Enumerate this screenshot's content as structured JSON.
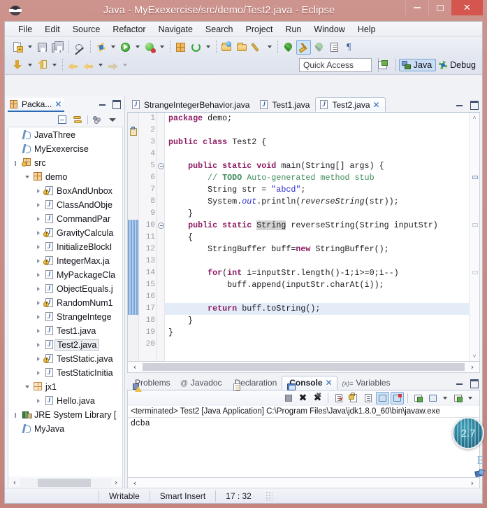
{
  "window": {
    "title": "Java - MyExexercise/src/demo/Test2.java - Eclipse",
    "app_icon": "eclipse-icon",
    "minimize": "minimize-icon",
    "maximize": "maximize-icon",
    "close": "✕"
  },
  "menubar": {
    "items": [
      "File",
      "Edit",
      "Source",
      "Refactor",
      "Navigate",
      "Search",
      "Project",
      "Run",
      "Window",
      "Help"
    ]
  },
  "toolbar": {
    "quick_access_placeholder": "Quick Access",
    "perspectives": [
      {
        "label": "Java",
        "icon": "java-perspective-icon",
        "selected": true
      },
      {
        "label": "Debug",
        "icon": "debug-perspective-icon",
        "selected": false
      }
    ],
    "open_perspective_icon": "open-perspective-icon",
    "row1_icons": [
      "new-wizard-icon",
      "save-icon",
      "save-all-icon",
      "skip-breakpoints-icon",
      "debug-icon",
      "run-icon",
      "run-coverage-icon",
      "new-java-package-icon",
      "external-tools-icon",
      "open-type-icon",
      "open-task-icon",
      "search-icon",
      "annotate-icon",
      "pin-icon",
      "toggle-mark-occurrences-icon",
      "next-annotation-icon",
      "show-whitespace-icon",
      "block-selection-icon"
    ],
    "row2_icons": [
      "previous-edit-icon",
      "next-edit-icon",
      "back-icon",
      "forward-history-icon",
      "forward-icon"
    ]
  },
  "explorer": {
    "view_title": "Packa...",
    "view_icon": "package-explorer-icon",
    "close_icon": "✕",
    "minimize_icon": "minimize-view-icon",
    "maximize_icon": "maximize-view-icon",
    "toolbar_icons": [
      "collapse-all-icon",
      "link-with-editor-icon",
      "focus-on-active-task-icon",
      "view-menu-icon"
    ],
    "tree": [
      {
        "label": "JavaThree",
        "indent": 0,
        "icon": "java-project-icon",
        "twist": "none",
        "selected": false
      },
      {
        "label": "MyExexercise",
        "indent": 0,
        "icon": "java-project-icon",
        "twist": "none",
        "selected": false
      },
      {
        "label": "src",
        "indent": 0,
        "icon": "source-folder-icon",
        "twist": "thin",
        "selected": false
      },
      {
        "label": "demo",
        "indent": 1,
        "icon": "package-icon",
        "twist": "open",
        "selected": false
      },
      {
        "label": "BoxAndUnbox",
        "indent": 2,
        "icon": "java-file-warn-icon",
        "twist": "closed",
        "selected": false
      },
      {
        "label": "ClassAndObje",
        "indent": 2,
        "icon": "java-file-icon",
        "twist": "closed",
        "selected": false
      },
      {
        "label": "CommandPar",
        "indent": 2,
        "icon": "java-file-icon",
        "twist": "closed",
        "selected": false
      },
      {
        "label": "GravityCalcula",
        "indent": 2,
        "icon": "java-file-warn-icon",
        "twist": "closed",
        "selected": false
      },
      {
        "label": "InitializeBlockI",
        "indent": 2,
        "icon": "java-file-icon",
        "twist": "closed",
        "selected": false
      },
      {
        "label": "IntegerMax.ja",
        "indent": 2,
        "icon": "java-file-warn-icon",
        "twist": "closed",
        "selected": false
      },
      {
        "label": "MyPackageCla",
        "indent": 2,
        "icon": "java-file-icon",
        "twist": "closed",
        "selected": false
      },
      {
        "label": "ObjectEquals.j",
        "indent": 2,
        "icon": "java-file-icon",
        "twist": "closed",
        "selected": false
      },
      {
        "label": "RandomNum1",
        "indent": 2,
        "icon": "java-file-warn-icon",
        "twist": "closed",
        "selected": false
      },
      {
        "label": "StrangeIntege",
        "indent": 2,
        "icon": "java-file-icon",
        "twist": "closed",
        "selected": false
      },
      {
        "label": "Test1.java",
        "indent": 2,
        "icon": "java-file-icon",
        "twist": "closed",
        "selected": false
      },
      {
        "label": "Test2.java",
        "indent": 2,
        "icon": "java-file-icon",
        "twist": "closed",
        "selected": true
      },
      {
        "label": "TestStatic.java",
        "indent": 2,
        "icon": "java-file-warn-icon",
        "twist": "closed",
        "selected": false
      },
      {
        "label": "TestStaticInitia",
        "indent": 2,
        "icon": "java-file-icon",
        "twist": "closed",
        "selected": false
      },
      {
        "label": "jx1",
        "indent": 1,
        "icon": "package-plain-icon",
        "twist": "open",
        "selected": false
      },
      {
        "label": "Hello.java",
        "indent": 2,
        "icon": "java-file-icon",
        "twist": "closed",
        "selected": false
      },
      {
        "label": "JRE System Library [",
        "indent": 0,
        "icon": "jre-library-icon",
        "twist": "thin",
        "selected": false
      },
      {
        "label": "MyJava",
        "indent": 0,
        "icon": "java-project-icon",
        "twist": "none",
        "selected": false
      }
    ],
    "hscroll": {
      "left_arrow": "‹",
      "right_arrow": "›"
    }
  },
  "editor": {
    "tabs": [
      {
        "label": "StrangeIntegerBehavior.java",
        "icon": "java-file-icon",
        "active": false,
        "closable": false
      },
      {
        "label": "Test1.java",
        "icon": "java-file-icon",
        "active": false,
        "closable": false
      },
      {
        "label": "Test2.java",
        "icon": "java-file-icon",
        "active": true,
        "closable": true,
        "close_icon": "✕"
      }
    ],
    "minimize_icon": "minimize-editor-icon",
    "maximize_icon": "maximize-editor-icon",
    "scroll_up_icon": "˄",
    "scroll_down_icon": "˅",
    "hscroll": {
      "left_arrow": "‹",
      "right_arrow": "›"
    },
    "lines": [
      {
        "n": 1,
        "fold": false,
        "changed": false,
        "hl": false,
        "tokens": [
          {
            "t": "package ",
            "c": "kw"
          },
          {
            "t": "demo;",
            "c": ""
          }
        ]
      },
      {
        "n": 2,
        "fold": false,
        "changed": false,
        "hl": false,
        "tokens": []
      },
      {
        "n": 3,
        "fold": false,
        "changed": false,
        "hl": false,
        "tokens": [
          {
            "t": "public class ",
            "c": "kw"
          },
          {
            "t": "Test2 {",
            "c": ""
          }
        ]
      },
      {
        "n": 4,
        "fold": false,
        "changed": false,
        "hl": false,
        "tokens": []
      },
      {
        "n": 5,
        "fold": true,
        "changed": false,
        "hl": false,
        "tokens": [
          {
            "t": "    ",
            "c": ""
          },
          {
            "t": "public static void ",
            "c": "kw"
          },
          {
            "t": "main(String[] args) {",
            "c": ""
          }
        ]
      },
      {
        "n": 6,
        "fold": false,
        "changed": false,
        "hl": false,
        "tokens": [
          {
            "t": "        ",
            "c": ""
          },
          {
            "t": "// ",
            "c": "cmt"
          },
          {
            "t": "TODO",
            "c": "todo"
          },
          {
            "t": " Auto-generated method stub",
            "c": "cmt"
          }
        ]
      },
      {
        "n": 7,
        "fold": false,
        "changed": false,
        "hl": false,
        "tokens": [
          {
            "t": "        String str = ",
            "c": ""
          },
          {
            "t": "\"abcd\"",
            "c": "str"
          },
          {
            "t": ";",
            "c": ""
          }
        ]
      },
      {
        "n": 8,
        "fold": false,
        "changed": false,
        "hl": false,
        "tokens": [
          {
            "t": "        System.",
            "c": ""
          },
          {
            "t": "out",
            "c": "fld"
          },
          {
            "t": ".println(",
            "c": ""
          },
          {
            "t": "reverseString",
            "c": "mth"
          },
          {
            "t": "(str));",
            "c": ""
          }
        ]
      },
      {
        "n": 9,
        "fold": false,
        "changed": false,
        "hl": false,
        "tokens": [
          {
            "t": "    }",
            "c": ""
          }
        ]
      },
      {
        "n": 10,
        "fold": true,
        "changed": true,
        "hl": false,
        "tokens": [
          {
            "t": "    ",
            "c": ""
          },
          {
            "t": "public static ",
            "c": "kw"
          },
          {
            "t": "String",
            "c": "hl-occ"
          },
          {
            "t": " reverseString(String inputStr)",
            "c": ""
          }
        ]
      },
      {
        "n": 11,
        "fold": false,
        "changed": true,
        "hl": false,
        "tokens": [
          {
            "t": "    {",
            "c": ""
          }
        ]
      },
      {
        "n": 12,
        "fold": false,
        "changed": true,
        "hl": false,
        "tokens": [
          {
            "t": "        StringBuffer buff=",
            "c": ""
          },
          {
            "t": "new ",
            "c": "kw"
          },
          {
            "t": "StringBuffer();",
            "c": ""
          }
        ]
      },
      {
        "n": 13,
        "fold": false,
        "changed": true,
        "hl": false,
        "tokens": []
      },
      {
        "n": 14,
        "fold": false,
        "changed": true,
        "hl": false,
        "tokens": [
          {
            "t": "        ",
            "c": ""
          },
          {
            "t": "for",
            "c": "kw"
          },
          {
            "t": "(",
            "c": ""
          },
          {
            "t": "int",
            "c": "kw"
          },
          {
            "t": " i=inputStr.length()-1;i>=0;i--)",
            "c": ""
          }
        ]
      },
      {
        "n": 15,
        "fold": false,
        "changed": true,
        "hl": false,
        "tokens": [
          {
            "t": "            buff.append(inputStr.charAt(i));",
            "c": ""
          }
        ]
      },
      {
        "n": 16,
        "fold": false,
        "changed": true,
        "hl": false,
        "tokens": []
      },
      {
        "n": 17,
        "fold": false,
        "changed": true,
        "hl": true,
        "tokens": [
          {
            "t": "        ",
            "c": ""
          },
          {
            "t": "return ",
            "c": "kw"
          },
          {
            "t": "buff.toString();",
            "c": ""
          }
        ]
      },
      {
        "n": 18,
        "fold": false,
        "changed": true,
        "hl": false,
        "tokens": [
          {
            "t": "    }",
            "c": ""
          }
        ]
      },
      {
        "n": 19,
        "fold": false,
        "changed": false,
        "hl": false,
        "tokens": [
          {
            "t": "}",
            "c": ""
          }
        ]
      },
      {
        "n": 20,
        "fold": false,
        "changed": false,
        "hl": false,
        "tokens": []
      }
    ],
    "todo_marker": "task-marker-icon"
  },
  "console": {
    "tabs": [
      {
        "label": "Problems",
        "icon": "problems-icon",
        "active": false,
        "closable": false
      },
      {
        "label": "Javadoc",
        "icon": "javadoc-icon",
        "active": false,
        "closable": false
      },
      {
        "label": "Declaration",
        "icon": "declaration-icon",
        "active": false,
        "closable": false
      },
      {
        "label": "Console",
        "icon": "console-icon",
        "active": true,
        "closable": true,
        "close_icon": "✕"
      },
      {
        "label": "Variables",
        "icon": "variables-icon",
        "active": false,
        "closable": false
      }
    ],
    "minimize_icon": "minimize-console-icon",
    "maximize_icon": "maximize-console-icon",
    "toolbar_icons": [
      "terminate-icon",
      "remove-launch-icon",
      "remove-all-terminated-icon",
      "clear-console-icon",
      "scroll-lock-icon",
      "word-wrap-icon",
      "show-console-on-output-icon",
      "show-console-on-error-icon",
      "pin-console-icon",
      "display-selected-console-icon",
      "open-console-icon"
    ],
    "header_line": "<terminated> Test2 [Java Application] C:\\Program Files\\Java\\jdk1.8.0_60\\bin\\javaw.exe ",
    "output": "dcba",
    "hscroll": {
      "left_arrow": "‹",
      "right_arrow": "›"
    }
  },
  "statusbar": {
    "writable": "Writable",
    "insert_mode": "Smart Insert",
    "cursor_position": "17 : 32"
  },
  "overlay": {
    "badge_text": "2.7",
    "side_glyph_letter": "E",
    "side_glyph_icon": "ime-indicator-icon"
  },
  "colors": {
    "title_bar": "#c98b85",
    "close_button": "#d4564f",
    "accent_blue": "#2a6ab5",
    "keyword": "#8d1c63",
    "string": "#2a2ad0",
    "comment": "#3f8c5a",
    "selection": "#e4ecf8"
  }
}
